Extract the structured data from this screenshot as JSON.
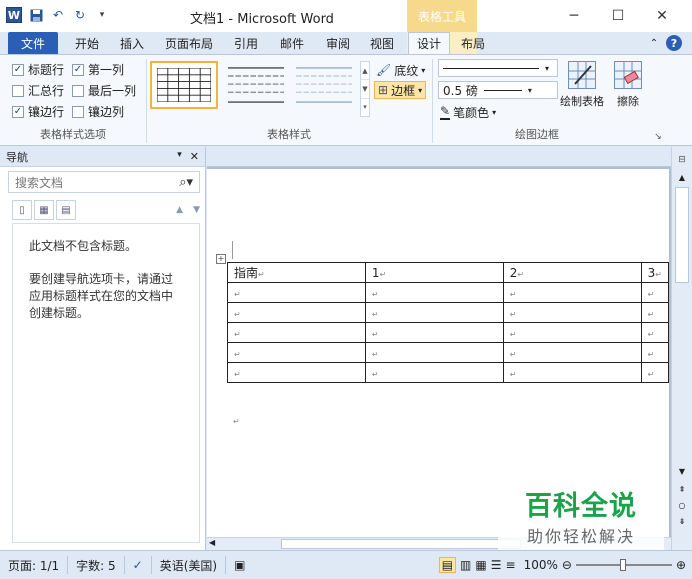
{
  "app": {
    "title": "文档1 - Microsoft Word",
    "context_header": "表格工具",
    "qat_logo": "W",
    "window_controls": {
      "minimize": "─",
      "maximize": "☐",
      "close": "✕"
    }
  },
  "tabs": [
    {
      "label": "文件"
    },
    {
      "label": "开始"
    },
    {
      "label": "插入"
    },
    {
      "label": "页面布局"
    },
    {
      "label": "引用"
    },
    {
      "label": "邮件"
    },
    {
      "label": "审阅"
    },
    {
      "label": "视图"
    },
    {
      "label": "设计"
    },
    {
      "label": "布局"
    }
  ],
  "ribbon": {
    "options_group": {
      "label": "表格样式选项",
      "checks": [
        {
          "label": "标题行",
          "checked": true
        },
        {
          "label": "第一列",
          "checked": true
        },
        {
          "label": "汇总行",
          "checked": false
        },
        {
          "label": "最后一列",
          "checked": false
        },
        {
          "label": "镶边行",
          "checked": true
        },
        {
          "label": "镶边列",
          "checked": false
        }
      ]
    },
    "styles_group": {
      "label": "表格样式",
      "shading": "底纹",
      "borders": "边框"
    },
    "draw_group": {
      "label": "绘图边框",
      "line_weight": "0.5 磅",
      "pen_color": "笔颜色",
      "draw_table": "绘制表格",
      "eraser": "擦除"
    }
  },
  "nav": {
    "title": "导航",
    "search_placeholder": "搜索文档",
    "message1": "此文档不包含标题。",
    "message2": "要创建导航选项卡，请通过应用标题样式在您的文档中创建标题。"
  },
  "table": {
    "header": [
      "指南",
      "1",
      "2",
      "3"
    ],
    "rows": 6
  },
  "status": {
    "page": "页面: 1/1",
    "words": "字数: 5",
    "language": "英语(美国)",
    "zoom": "100%"
  },
  "watermark": {
    "title": "百科全说",
    "subtitle": "助你轻松解决"
  },
  "colors": {
    "file_tab": "#2b5fb5",
    "context": "#f6d98a",
    "watermark": "#1aa34a"
  }
}
